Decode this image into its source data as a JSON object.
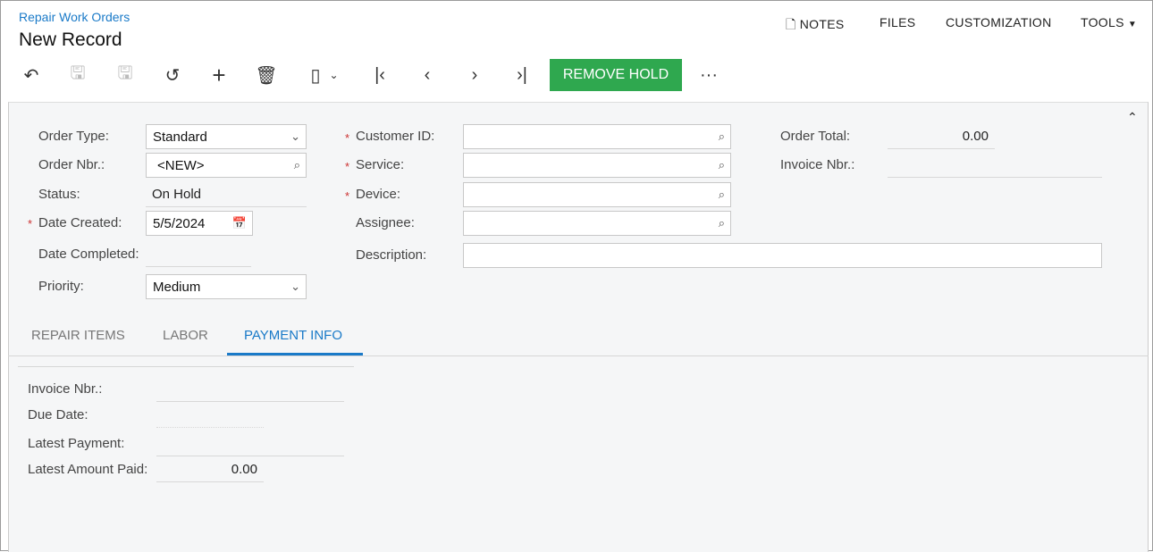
{
  "header": {
    "breadcrumb": "Repair Work Orders",
    "title": "New Record",
    "menu": [
      "NOTES",
      "FILES",
      "CUSTOMIZATION",
      "TOOLS"
    ]
  },
  "toolbar": {
    "remove_hold": "REMOVE HOLD",
    "more": "···"
  },
  "form": {
    "order_type": {
      "label": "Order Type:",
      "value": "Standard"
    },
    "order_nbr": {
      "label": "Order Nbr.:",
      "value": "<NEW>"
    },
    "status": {
      "label": "Status:",
      "value": "On Hold"
    },
    "date_created": {
      "label": "Date Created:",
      "value": "5/5/2024"
    },
    "date_completed": {
      "label": "Date Completed:",
      "value": ""
    },
    "priority": {
      "label": "Priority:",
      "value": "Medium"
    },
    "customer_id": {
      "label": "Customer ID:",
      "value": ""
    },
    "service": {
      "label": "Service:",
      "value": ""
    },
    "device": {
      "label": "Device:",
      "value": ""
    },
    "assignee": {
      "label": "Assignee:",
      "value": ""
    },
    "description": {
      "label": "Description:",
      "value": ""
    },
    "order_total": {
      "label": "Order Total:",
      "value": "0.00"
    },
    "invoice_nbr": {
      "label": "Invoice Nbr.:",
      "value": ""
    }
  },
  "tabs": [
    "REPAIR ITEMS",
    "LABOR",
    "PAYMENT INFO"
  ],
  "payment": {
    "invoice_nbr": {
      "label": "Invoice Nbr.:",
      "value": ""
    },
    "due_date": {
      "label": "Due Date:",
      "value": ""
    },
    "latest_payment": {
      "label": "Latest Payment:",
      "value": ""
    },
    "latest_amount": {
      "label": "Latest Amount Paid:",
      "value": "0.00"
    }
  },
  "req_mark": "*"
}
